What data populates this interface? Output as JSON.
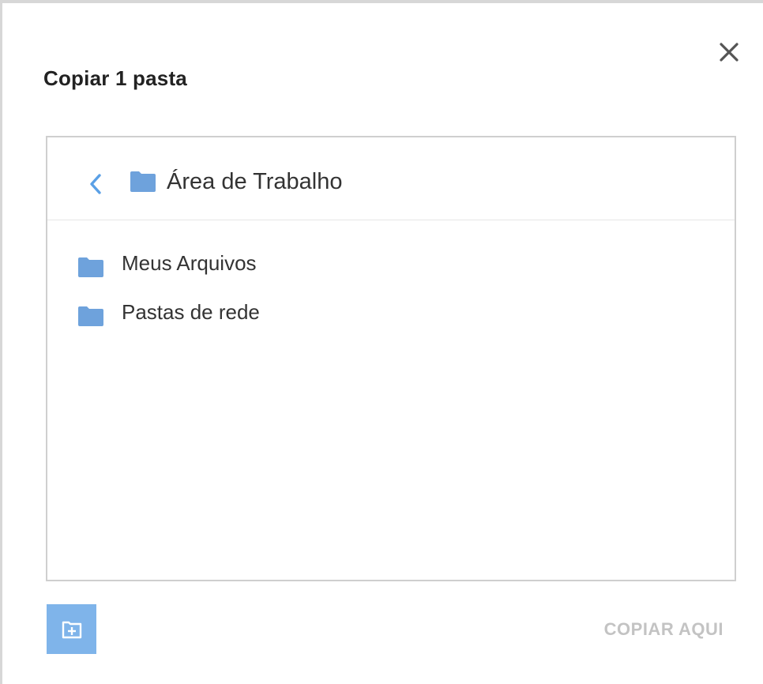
{
  "dialog": {
    "title": "Copiar 1 pasta",
    "close_icon": "close-icon"
  },
  "browser": {
    "current_folder": "Área de Trabalho",
    "back_icon": "chevron-left-icon",
    "folder_icon": "folder-icon",
    "items": [
      {
        "label": "Meus Arquivos",
        "icon": "folder-icon"
      },
      {
        "label": "Pastas de rede",
        "icon": "folder-icon"
      }
    ]
  },
  "footer": {
    "new_folder_icon": "new-folder-icon",
    "copy_here_label": "COPIAR AQUI"
  },
  "colors": {
    "accent": "#7fb4ea",
    "folder": "#6ea2dc",
    "chevron": "#5aa0e6",
    "disabled_text": "#c3c3c3",
    "title_text": "#222222"
  }
}
